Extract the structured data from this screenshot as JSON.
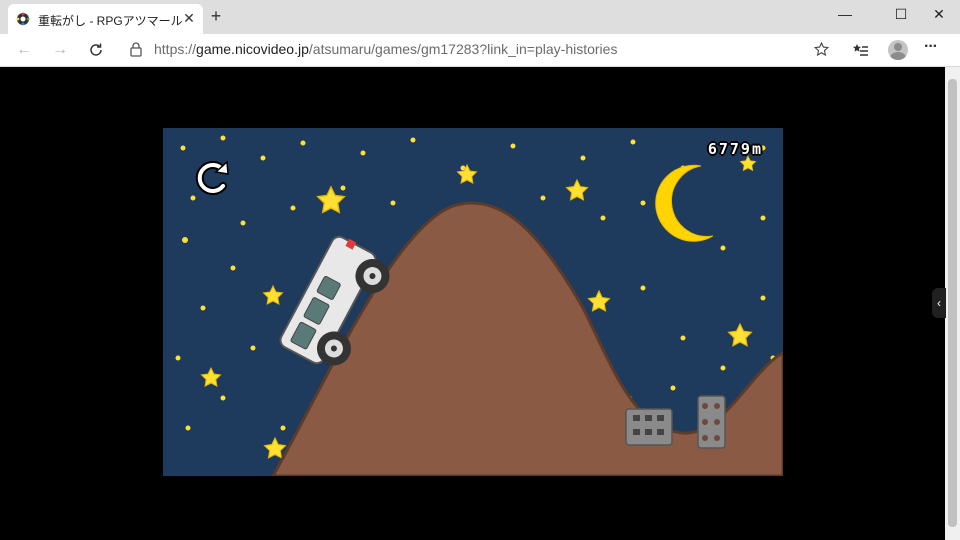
{
  "browser": {
    "tab": {
      "title": "重転がし - RPGアツマール",
      "close_glyph": "✕"
    },
    "new_tab_glyph": "+",
    "window": {
      "minimize": "—",
      "maximize": "☐",
      "close": "✕"
    },
    "nav": {
      "back_glyph": "←",
      "forward_glyph": "→"
    },
    "address": {
      "scheme": "https://",
      "host": "game.nicovideo.jp",
      "path": "/atsumaru/games/gm17283?link_in=play-histories"
    },
    "toolbar": {
      "menu_glyph": "···"
    }
  },
  "sidebar_toggle": "‹",
  "game": {
    "distance": "6779m",
    "colors": {
      "sky": "#1e3a5c",
      "hill": "#8a5a44",
      "star": "#ffe033",
      "moon": "#ffd400"
    }
  }
}
